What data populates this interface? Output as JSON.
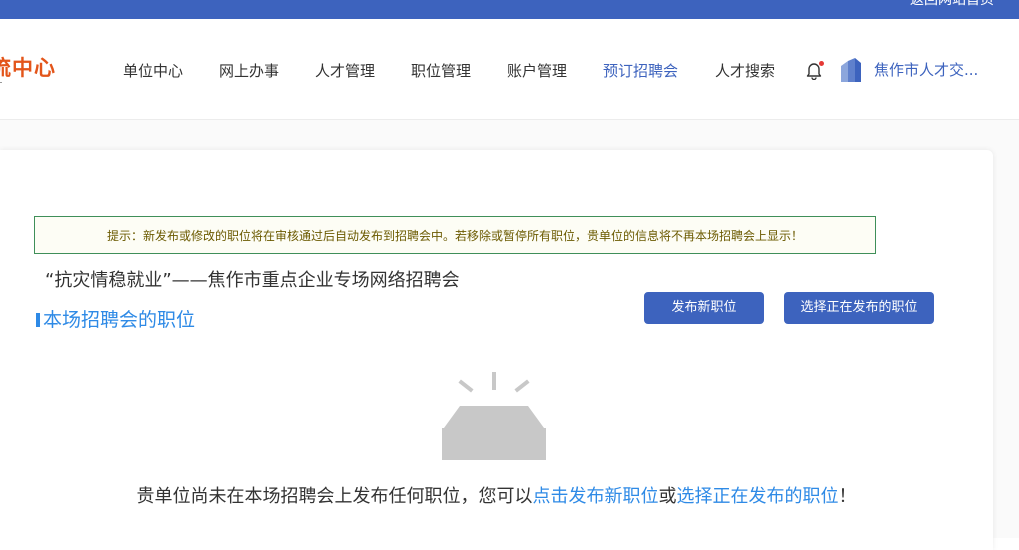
{
  "topbar": {
    "home_link": "返回网站首页"
  },
  "header": {
    "logo_text": "流中心"
  },
  "nav": {
    "items": [
      {
        "label": "单位中心"
      },
      {
        "label": "网上办事"
      },
      {
        "label": "人才管理"
      },
      {
        "label": "职位管理"
      },
      {
        "label": "账户管理"
      },
      {
        "label": "预订招聘会"
      },
      {
        "label": "人才搜索"
      }
    ],
    "active": "预订招聘会",
    "notification_icon": "bell-icon",
    "account_name": "焦作市人才交..."
  },
  "notice": {
    "text": "提示：新发布或修改的职位将在审核通过后自动发布到招聘会中。若移除或暂停所有职位，贵单位的信息将不再本场招聘会上显示！"
  },
  "fair": {
    "title": "“抗灾情稳就业”——焦作市重点企业专场网络招聘会",
    "section_title": "本场招聘会的职位"
  },
  "actions": {
    "publish_label": "发布新职位",
    "select_label": "选择正在发布的职位"
  },
  "empty": {
    "icon": "empty-inbox-icon",
    "prefix": "贵单位尚未在本场招聘会上发布任何职位，您可以",
    "link_publish": "点击发布新职位",
    "middle": "或",
    "link_select": "选择正在发布的职位",
    "suffix": "！"
  },
  "colors": {
    "primary": "#3d63be",
    "link": "#2e8ae6",
    "logo": "#e3551a",
    "notice_border": "#3f8f59",
    "notice_text": "#6b5a00",
    "empty_icon": "#c8c8c8"
  }
}
